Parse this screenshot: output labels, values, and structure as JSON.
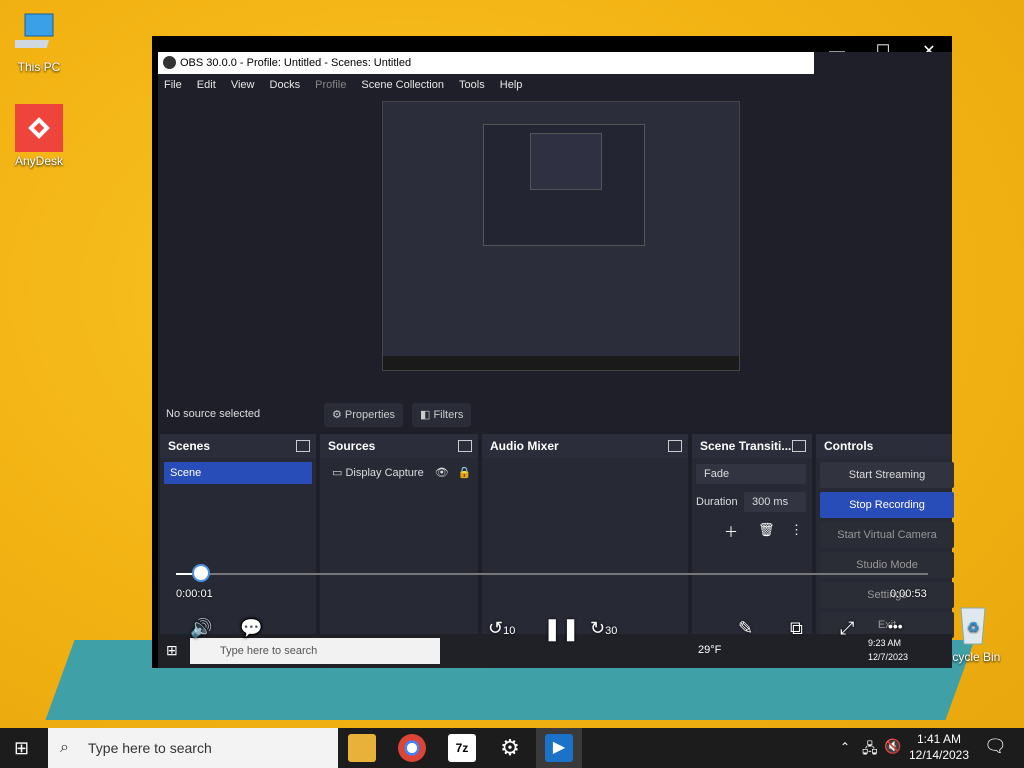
{
  "desktop": {
    "icons": [
      {
        "name": "this-pc",
        "label": "This PC"
      },
      {
        "name": "anydesk",
        "label": "AnyDesk"
      },
      {
        "name": "recycle-bin",
        "label": "ecycle Bin"
      }
    ]
  },
  "player": {
    "current_time": "0:00:01",
    "total_time": "0:00:53",
    "progress_fraction": 0.02,
    "skip_back": "10",
    "skip_forward": "30"
  },
  "obs": {
    "title": "OBS 30.0.0 - Profile: Untitled - Scenes: Untitled",
    "menu": [
      "File",
      "Edit",
      "View",
      "Docks",
      "Profile",
      "Scene Collection",
      "Tools",
      "Help"
    ],
    "no_source": "No source selected",
    "properties": "Properties",
    "filters": "Filters",
    "docks": {
      "scenes": "Scenes",
      "sources": "Sources",
      "audio_mixer": "Audio Mixer",
      "transitions": "Scene Transiti...",
      "controls": "Controls"
    },
    "scene_item": "Scene",
    "source_item": "Display Capture",
    "transition": "Fade",
    "duration_label": "Duration",
    "duration_value": "300 ms",
    "controls": {
      "start_streaming": "Start Streaming",
      "stop_recording": "Stop Recording",
      "start_virtual": "Start Virtual Camera",
      "studio_mode": "Studio Mode",
      "settings": "Settings",
      "exit": "Exit"
    },
    "inner_taskbar": {
      "search": "Type here to search",
      "weather": "29°F",
      "time": "9:23 AM",
      "date": "12/7/2023"
    }
  },
  "taskbar": {
    "search_placeholder": "Type here to search",
    "time": "1:41 AM",
    "date": "12/14/2023"
  }
}
